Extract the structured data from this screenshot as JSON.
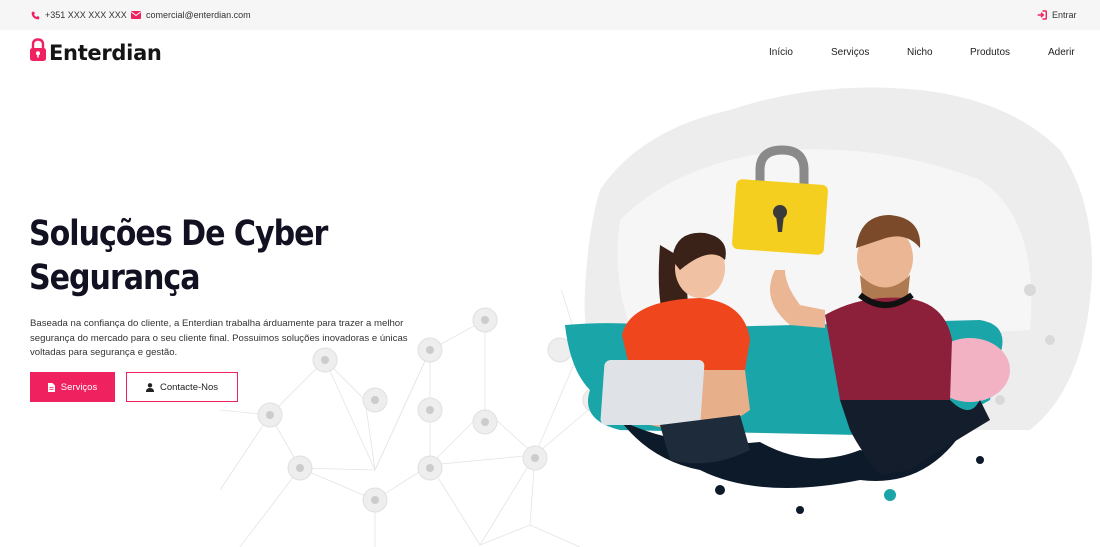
{
  "topbar": {
    "phone": "+351 XXX XXX XXX",
    "email": "comercial@enterdian.com",
    "login": "Entrar",
    "icons": [
      "phone-icon",
      "mail-icon",
      "login-icon"
    ]
  },
  "brand": {
    "name": "Enterdian",
    "icon": "padlock-logo-icon"
  },
  "nav": {
    "items": [
      "Início",
      "Serviços",
      "Nicho",
      "Produtos",
      "Aderir"
    ]
  },
  "hero": {
    "title_line1": "Soluções De Cyber",
    "title_line2": "Segurança",
    "description": "Baseada na confiança do cliente, a Enterdian trabalha árduamente para trazer a melhor segurança do mercado para o seu cliente final. Possuimos soluções inovadoras e únicas voltadas para segurança e gestão.",
    "btn_services": "Serviços",
    "btn_contact": "Contacte-Nos",
    "btn_services_icon": "document-icon",
    "btn_contact_icon": "user-icon"
  },
  "colors": {
    "accent": "#f0215f",
    "topbar_bg": "#f6f6f6",
    "text_dark": "#111122",
    "padlock": "#f5cf1f",
    "sofa": "#1aa5a9"
  }
}
